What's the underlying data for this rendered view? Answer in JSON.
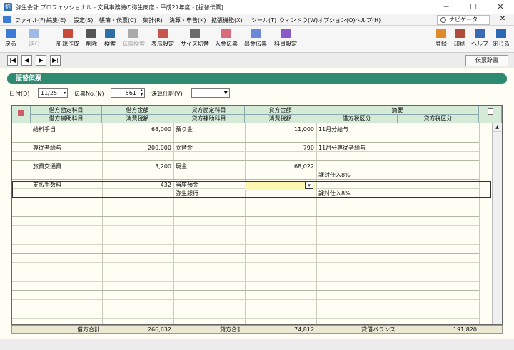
{
  "window": {
    "title": "弥生会計 プロフェッショナル - 文具事務機の弥生商店 - 平成27年度 - [振替伝票]",
    "controls": [
      "─",
      "☐",
      "✕"
    ]
  },
  "menu": {
    "items": [
      "ファイル(F)",
      "編集(E)",
      "設定(S)",
      "帳簿・伝票(C)",
      "集計(R)",
      "決算・申告(K)",
      "拡張機能(X)",
      "ツール(T)",
      "ウィンドウ(W)",
      "オプション(O)",
      "ヘルプ(H)"
    ],
    "navigator": "ナビゲータ",
    "close": "✕"
  },
  "toolbar": {
    "left": [
      {
        "label": "戻る",
        "color": "#3a7bd5"
      },
      {
        "label": "進む",
        "color": "#9dbbe6",
        "disabled": true
      },
      {
        "label": "新規作成",
        "color": "#c94a3b"
      },
      {
        "label": "削除",
        "color": "#555"
      },
      {
        "label": "検索",
        "color": "#2e6fa7"
      },
      {
        "label": "伝票検索",
        "color": "#aaa",
        "disabled": true
      },
      {
        "label": "表示設定",
        "color": "#c9554a"
      },
      {
        "label": "サイズ切替",
        "color": "#6a6a6a"
      },
      {
        "label": "入金伝票",
        "color": "#d96a7a"
      },
      {
        "label": "出金伝票",
        "color": "#6a8ad9"
      },
      {
        "label": "科目設定",
        "color": "#8a5ac9"
      }
    ],
    "right": [
      {
        "label": "登録",
        "color": "#e08a2a"
      },
      {
        "label": "印刷",
        "color": "#b04a3a"
      },
      {
        "label": "ヘルプ",
        "color": "#3a6ab5"
      },
      {
        "label": "閉じる",
        "color": "#2a6ab5"
      }
    ]
  },
  "navbar": {
    "buttons": [
      "|◀",
      "◀",
      "▶",
      "▶|"
    ],
    "slip_dictionary": "伝票辞書"
  },
  "form": {
    "title": "振替伝票",
    "date_label": "日付(D)",
    "date_value": "11/25",
    "slip_no_label": "伝票No.(N)",
    "slip_no_value": "561",
    "closing_label": "決算仕訳(V)",
    "closing_value": ""
  },
  "grid": {
    "headers_top": [
      "借方勘定科目",
      "借方金額",
      "貸方勘定科目",
      "貸方金額",
      "摘要"
    ],
    "headers_bottom": [
      "借方補助科目",
      "消費税額",
      "貸方補助科目",
      "消費税額",
      "借方税区分",
      "貸方税区分"
    ],
    "rows": [
      {
        "debit_account": "給料手当",
        "debit_amount": "68,000",
        "credit_account": "預り金",
        "credit_amount": "11,000",
        "memo": "11月分給与",
        "debit_sub": "",
        "debit_tax": "",
        "credit_sub": "",
        "credit_tax": "",
        "debit_tax_class": "",
        "credit_tax_class": ""
      },
      {
        "debit_account": "専従者給与",
        "debit_amount": "200,000",
        "credit_account": "立替金",
        "credit_amount": "790",
        "memo": "11月分専従者給与",
        "debit_sub": "",
        "debit_tax": "",
        "credit_sub": "",
        "credit_tax": "",
        "debit_tax_class": "",
        "credit_tax_class": ""
      },
      {
        "debit_account": "旅費交通費",
        "debit_amount": "3,200",
        "credit_account": "現金",
        "credit_amount": "68,022",
        "memo": "",
        "debit_sub": "",
        "debit_tax": "",
        "credit_sub": "",
        "credit_tax": "",
        "debit_tax_class": "課対仕入8%",
        "credit_tax_class": ""
      },
      {
        "debit_account": "支払手数料",
        "debit_amount": "432",
        "credit_account": "当座預金",
        "credit_amount": "",
        "memo": "",
        "debit_sub": "",
        "debit_tax": "",
        "credit_sub": "弥生銀行",
        "credit_tax": "",
        "debit_tax_class": "課対仕入8%",
        "credit_tax_class": ""
      }
    ]
  },
  "footer": {
    "debit_total_label": "借方合計",
    "debit_total": "266,632",
    "credit_total_label": "貸方合計",
    "credit_total": "74,812",
    "balance_label": "貸借バランス",
    "balance": "191,820"
  }
}
